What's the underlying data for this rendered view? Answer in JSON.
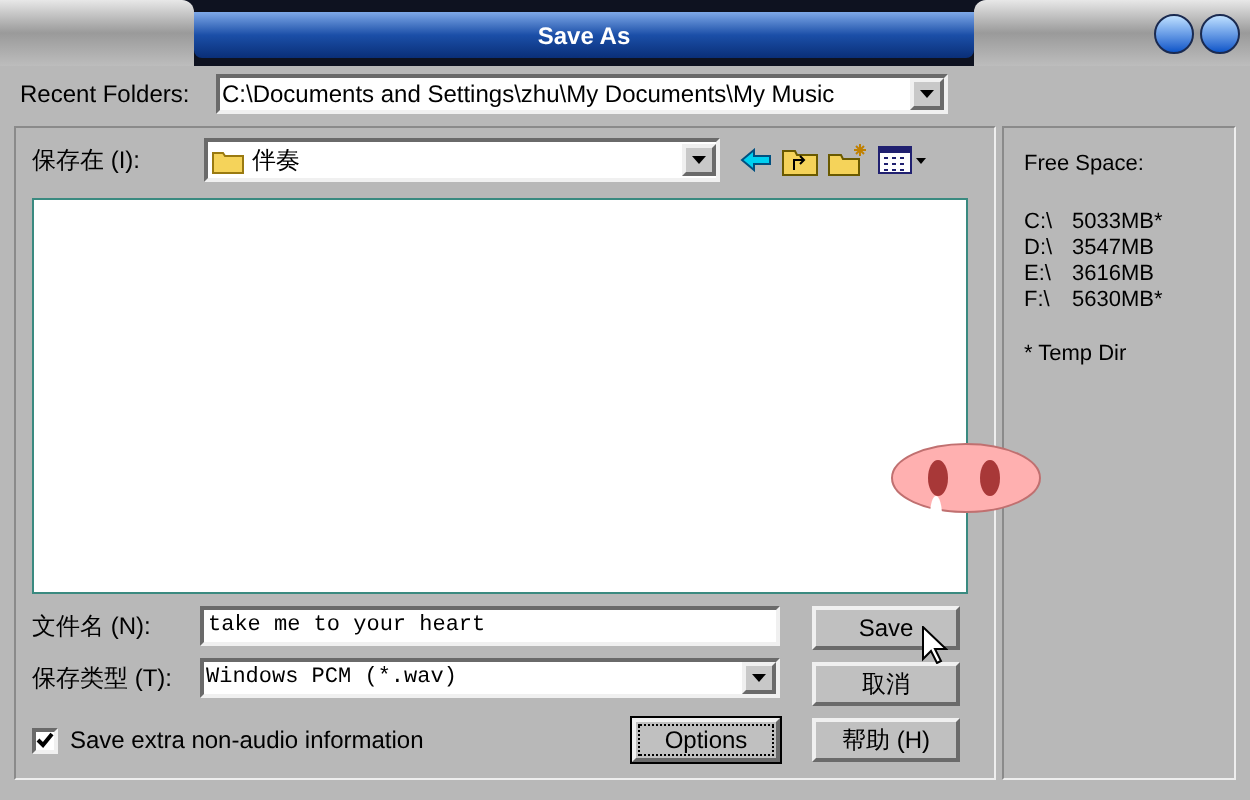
{
  "window": {
    "title": "Save As"
  },
  "recent_folders": {
    "label": "Recent Folders:",
    "value": "C:\\Documents and Settings\\zhu\\My Documents\\My Music"
  },
  "save_in": {
    "label": "保存在 (I):",
    "value": "伴奏"
  },
  "file_name": {
    "label": "文件名 (N):",
    "value": "take me to your heart"
  },
  "file_type": {
    "label": "保存类型 (T):",
    "value": "Windows PCM (*.wav)"
  },
  "extra_info": {
    "label": "Save extra non-audio information",
    "checked": true
  },
  "options_button": {
    "label": "Options",
    "focused": true
  },
  "buttons": [
    {
      "label": "Save"
    },
    {
      "label": "取消"
    },
    {
      "label": "帮助 (H)"
    }
  ],
  "free_space": {
    "title": "Free Space:",
    "drives": [
      {
        "drive": "C:\\",
        "size": "5033MB*"
      },
      {
        "drive": "D:\\",
        "size": "3547MB"
      },
      {
        "drive": "E:\\",
        "size": "3616MB"
      },
      {
        "drive": "F:\\",
        "size": "5630MB*"
      }
    ],
    "note": "* Temp Dir"
  }
}
